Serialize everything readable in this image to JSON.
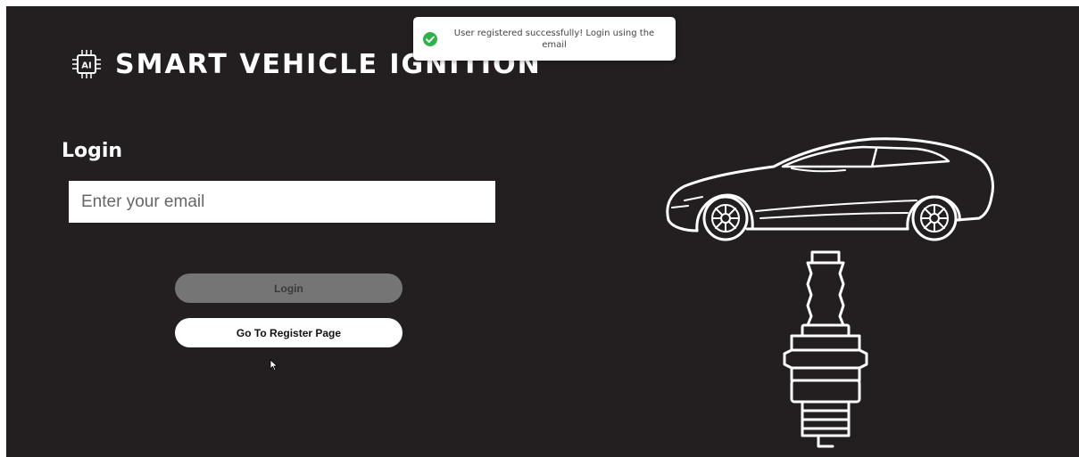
{
  "app": {
    "title": "SMART VEHICLE IGNITION",
    "logo_icon": "ai-chip-icon"
  },
  "toast": {
    "message": "User registered successfully! Login using the email",
    "icon": "check-circle-icon",
    "icon_color": "#2db34a"
  },
  "form": {
    "heading": "Login",
    "email_placeholder": "Enter your email",
    "email_value": "",
    "login_label": "Login",
    "register_label": "Go To Register Page"
  },
  "illustrations": {
    "car": "car-outline-icon",
    "spark_plug": "spark-plug-icon"
  },
  "colors": {
    "background": "#231f20",
    "text": "#ffffff",
    "login_button": "#757575",
    "register_button": "#ffffff"
  }
}
